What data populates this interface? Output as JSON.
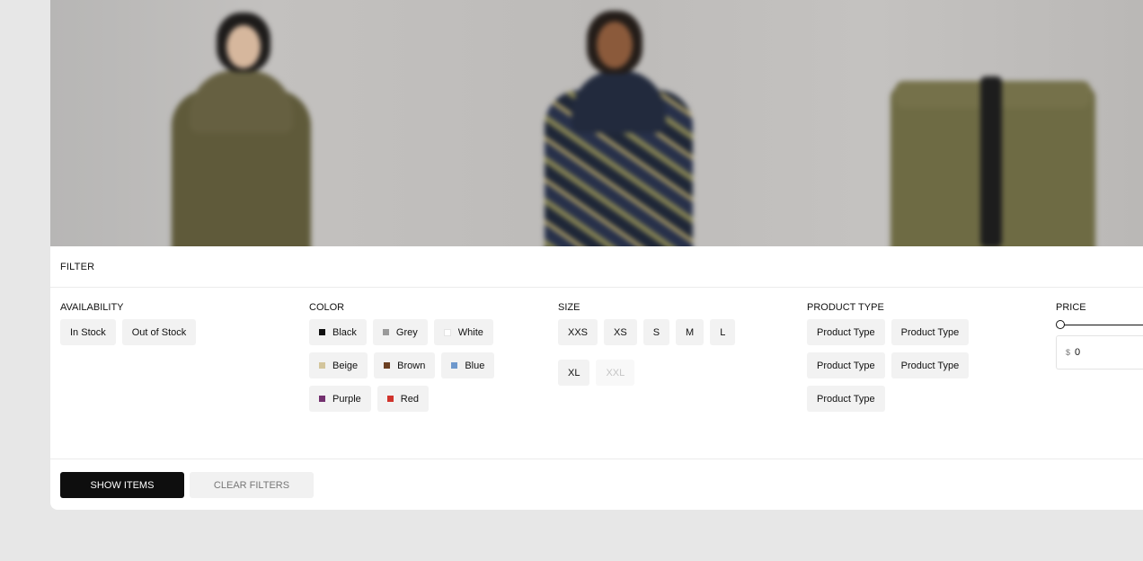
{
  "filter": {
    "title": "FILTER",
    "availability": {
      "title": "AVAILABILITY",
      "options": [
        "In Stock",
        "Out of Stock"
      ]
    },
    "color": {
      "title": "COLOR",
      "options": [
        {
          "label": "Black",
          "hex": "#111111"
        },
        {
          "label": "Grey",
          "hex": "#9a9a9a"
        },
        {
          "label": "White",
          "hex": "#ffffff"
        },
        {
          "label": "Beige",
          "hex": "#d3c59c"
        },
        {
          "label": "Brown",
          "hex": "#6b3f22"
        },
        {
          "label": "Blue",
          "hex": "#6e98cc"
        },
        {
          "label": "Purple",
          "hex": "#73306f"
        },
        {
          "label": "Red",
          "hex": "#d0342c"
        }
      ]
    },
    "size": {
      "title": "SIZE",
      "options": [
        {
          "label": "XXS",
          "available": true
        },
        {
          "label": "XS",
          "available": true
        },
        {
          "label": "S",
          "available": true
        },
        {
          "label": "M",
          "available": true
        },
        {
          "label": "L",
          "available": true
        },
        {
          "label": "XL",
          "available": true
        },
        {
          "label": "XXL",
          "available": false
        }
      ]
    },
    "product_type": {
      "title": "PRODUCT TYPE",
      "options": [
        "Product Type",
        "Product Type",
        "Product Type",
        "Product Type",
        "Product Type"
      ]
    },
    "price": {
      "title": "PRICE",
      "currency": "$",
      "min_value": "0"
    },
    "actions": {
      "show_items": "SHOW ITEMS",
      "clear_filters": "CLEAR FILTERS"
    }
  },
  "colors": {
    "primary_button": "#0e0e0e",
    "chip_background": "#f2f2f2",
    "page_background": "#e7e7e7"
  }
}
